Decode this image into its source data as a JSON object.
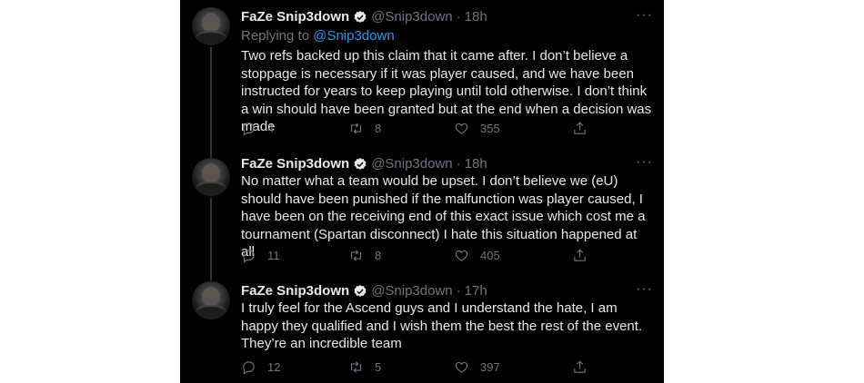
{
  "tweets": [
    {
      "author": "FaZe Snip3down",
      "handle": "@Snip3down",
      "separator": "·",
      "time": "18h",
      "replying_prefix": "Replying to",
      "replying_to": "@Snip3down",
      "text": "Two refs backed up this claim that it came after. I don’t believe a stoppage is necessary if it was player caused, and we have been instructed for years to keep playing until told otherwise. I don’t think a win should have been granted but at the end when a decision was made",
      "replies": "4",
      "retweets": "8",
      "likes": "355",
      "more": "···"
    },
    {
      "author": "FaZe Snip3down",
      "handle": "@Snip3down",
      "separator": "·",
      "time": "18h",
      "text": "No matter what a team would be upset. I don’t believe we (eU) should have been punished if the malfunction was player caused, I have been on the receiving end of this exact issue which cost me a tournament (Spartan disconnect) I hate this situation happened at all",
      "replies": "11",
      "retweets": "8",
      "likes": "405",
      "more": "···"
    },
    {
      "author": "FaZe Snip3down",
      "handle": "@Snip3down",
      "separator": "·",
      "time": "17h",
      "text": "I truly feel for the Ascend guys and I understand the hate, I am happy they qualified and I wish them the best the rest of the event. They’re an incredible team",
      "replies": "12",
      "retweets": "5",
      "likes": "397",
      "more": "···"
    }
  ],
  "colors": {
    "background": "#000000",
    "text": "#e7e9ea",
    "muted": "#71767b",
    "link": "#1d9bf0",
    "verified_badge": "#e7e9ea"
  },
  "icons": [
    "reply-icon",
    "retweet-icon",
    "like-icon",
    "share-icon",
    "verified-icon",
    "more-icon"
  ]
}
